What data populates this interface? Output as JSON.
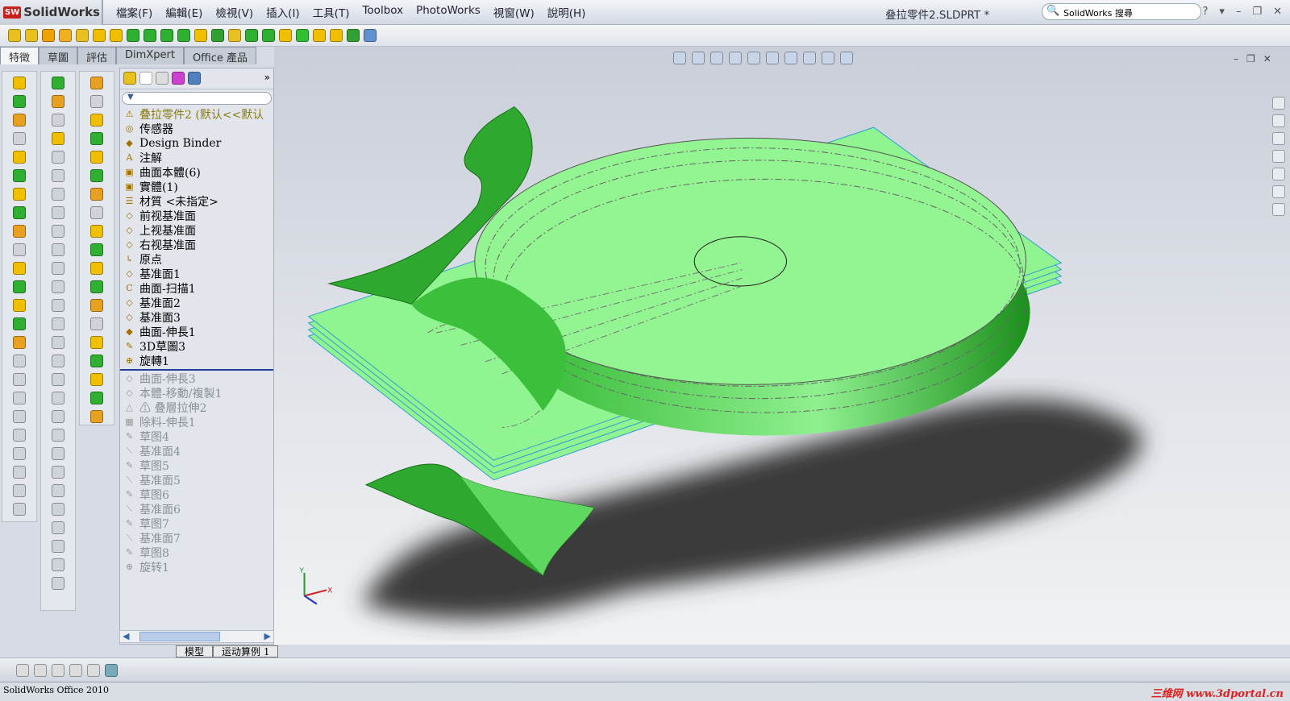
{
  "app": {
    "name": "SolidWorks",
    "logo_badge": "SW",
    "document_title": "叠拉零件2.SLDPRT *",
    "search_placeholder": "SolidWorks 搜尋"
  },
  "menu": [
    "檔案(F)",
    "編輯(E)",
    "檢視(V)",
    "插入(I)",
    "工具(T)",
    "Toolbox",
    "PhotoWorks",
    "視窗(W)",
    "說明(H)"
  ],
  "window_buttons": [
    "?",
    "▾",
    "–",
    "❐",
    "✕"
  ],
  "command_tabs": [
    {
      "label": "特徵",
      "active": true
    },
    {
      "label": "草圖"
    },
    {
      "label": "評估"
    },
    {
      "label": "DimXpert"
    },
    {
      "label": "Office 產品"
    }
  ],
  "toolbar_icon_colors": [
    "#e8c020",
    "#e8c020",
    "#f0a000",
    "#f0b020",
    "#e8c020",
    "#f0c000",
    "#f0c000",
    "#30b030",
    "#30b030",
    "#30b030",
    "#30b030",
    "#f0c000",
    "#30a030",
    "#e8c020",
    "#30b030",
    "#30b030",
    "#f0c000",
    "#30c030",
    "#f0c000",
    "#f0c000",
    "#30a030",
    "#6090d0"
  ],
  "feature_tree": {
    "filter_icon": "funnel-icon",
    "items": [
      {
        "label": "叠拉零件2 (默认<<默认",
        "icon": "warning-icon",
        "glyph": "⚠",
        "state": "root"
      },
      {
        "label": "传感器",
        "icon": "sensor-icon",
        "glyph": "◎"
      },
      {
        "label": "Design Binder",
        "icon": "binder-icon",
        "glyph": "◆"
      },
      {
        "label": "注解",
        "icon": "annotation-icon",
        "glyph": "A"
      },
      {
        "label": "曲面本體(6)",
        "icon": "surface-bodies-icon",
        "glyph": "▣"
      },
      {
        "label": "實體(1)",
        "icon": "solid-bodies-icon",
        "glyph": "▣"
      },
      {
        "label": "材質 <未指定>",
        "icon": "material-icon",
        "glyph": "☰"
      },
      {
        "label": "前视基准面",
        "icon": "plane-icon",
        "glyph": "◇"
      },
      {
        "label": "上视基准面",
        "icon": "plane-icon",
        "glyph": "◇"
      },
      {
        "label": "右视基准面",
        "icon": "plane-icon",
        "glyph": "◇"
      },
      {
        "label": "原点",
        "icon": "origin-icon",
        "glyph": "↳"
      },
      {
        "label": "基准面1",
        "icon": "plane-icon",
        "glyph": "◇"
      },
      {
        "label": "曲面-扫描1",
        "icon": "sweep-surface-icon",
        "glyph": "C"
      },
      {
        "label": "基准面2",
        "icon": "plane-icon",
        "glyph": "◇"
      },
      {
        "label": "基准面3",
        "icon": "plane-icon",
        "glyph": "◇"
      },
      {
        "label": "曲面-伸長1",
        "icon": "extrude-surface-icon",
        "glyph": "◆"
      },
      {
        "label": "3D草圖3",
        "icon": "sketch3d-icon",
        "glyph": "✎"
      },
      {
        "label": "旋轉1",
        "icon": "revolve-icon",
        "glyph": "⊕"
      },
      {
        "label": "曲面-伸長3",
        "icon": "extrude-surface-icon",
        "glyph": "◇",
        "state": "suppressed"
      },
      {
        "label": "本體-移動/複製1",
        "icon": "move-body-icon",
        "glyph": "◇",
        "state": "suppressed"
      },
      {
        "label": "⚠ 叠層拉伸2",
        "icon": "loft-icon",
        "glyph": "△",
        "state": "suppressed"
      },
      {
        "label": "除料-伸長1",
        "icon": "cut-extrude-icon",
        "glyph": "▦",
        "state": "suppressed"
      },
      {
        "label": "草图4",
        "icon": "sketch-icon",
        "glyph": "✎",
        "state": "suppressed"
      },
      {
        "label": "基准面4",
        "icon": "plane-icon",
        "glyph": "⟍",
        "state": "suppressed"
      },
      {
        "label": "草图5",
        "icon": "sketch-icon",
        "glyph": "✎",
        "state": "suppressed"
      },
      {
        "label": "基准面5",
        "icon": "plane-icon",
        "glyph": "⟍",
        "state": "suppressed"
      },
      {
        "label": "草图6",
        "icon": "sketch-icon",
        "glyph": "✎",
        "state": "suppressed"
      },
      {
        "label": "基准面6",
        "icon": "plane-icon",
        "glyph": "⟍",
        "state": "suppressed"
      },
      {
        "label": "草图7",
        "icon": "sketch-icon",
        "glyph": "✎",
        "state": "suppressed"
      },
      {
        "label": "基准面7",
        "icon": "plane-icon",
        "glyph": "⟍",
        "state": "suppressed"
      },
      {
        "label": "草图8",
        "icon": "sketch-icon",
        "glyph": "✎",
        "state": "suppressed"
      },
      {
        "label": "旋转1",
        "icon": "revolve-icon",
        "glyph": "⊕",
        "state": "suppressed"
      }
    ]
  },
  "bottom_tabs": [
    "模型",
    "运动算例 1"
  ],
  "status": {
    "text": "SolidWorks Office 2010",
    "watermark": "三维网 www.3dportal.cn"
  },
  "triad": {
    "x": "X",
    "y": "Y"
  },
  "colors": {
    "surface_light": "#90f590",
    "surface_dark": "#1f9a1f",
    "plane_edge": "#2f9fd0",
    "shadow": "#3a3a3a"
  }
}
